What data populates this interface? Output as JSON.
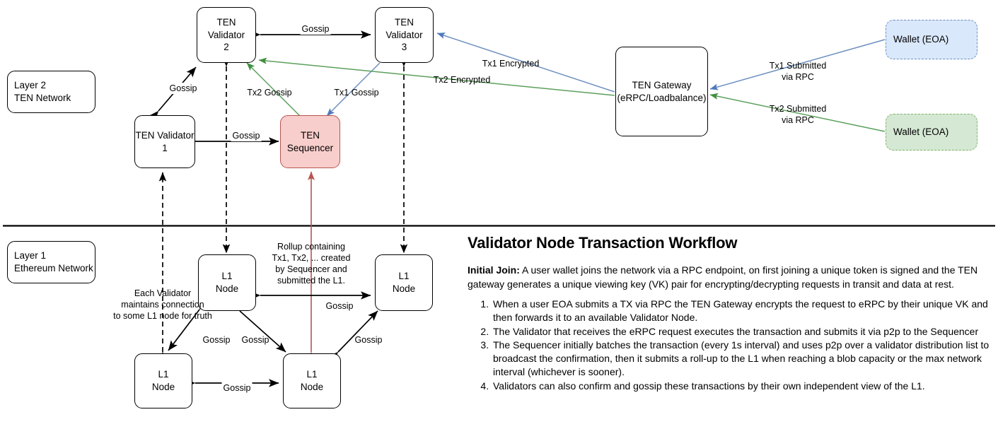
{
  "diagram": {
    "layers": [
      {
        "id": "layer2",
        "label": "Layer 2\nTEN Network"
      },
      {
        "id": "layer1",
        "label": "Layer 1\nEthereum Network"
      }
    ],
    "l2_nodes": [
      {
        "id": "validator2",
        "label": "TEN Validator\n2"
      },
      {
        "id": "validator3",
        "label": "TEN Validator\n3"
      },
      {
        "id": "validator1",
        "label": "TEN Validator\n1"
      },
      {
        "id": "sequencer",
        "label": "TEN\nSequencer"
      },
      {
        "id": "gateway",
        "label": "TEN Gateway\n(eRPC/Loadbalance)"
      }
    ],
    "wallets": [
      {
        "id": "wallet-blue",
        "label": "Wallet (EOA)"
      },
      {
        "id": "wallet-green",
        "label": "Wallet (EOA)"
      }
    ],
    "l1_nodes": [
      {
        "id": "l1-top-left",
        "label": "L1\nNode"
      },
      {
        "id": "l1-top-right",
        "label": "L1\nNode"
      },
      {
        "id": "l1-bottom-left",
        "label": "L1\nNode"
      },
      {
        "id": "l1-bottom-right",
        "label": "L1\nNode"
      }
    ],
    "edge_labels": [
      {
        "id": "gossip-v2-v3",
        "text": "Gossip"
      },
      {
        "id": "gossip-v1-v2",
        "text": "Gossip"
      },
      {
        "id": "gossip-v1-seq",
        "text": "Gossip"
      },
      {
        "id": "tx2-gossip",
        "text": "Tx2 Gossip"
      },
      {
        "id": "tx1-gossip",
        "text": "Tx1 Gossip"
      },
      {
        "id": "tx1-encrypted",
        "text": "Tx1 Encrypted"
      },
      {
        "id": "tx2-encrypted",
        "text": "Tx2 Encrypted"
      },
      {
        "id": "tx1-submitted",
        "text": "Tx1 Submitted\nvia RPC"
      },
      {
        "id": "tx2-submitted",
        "text": "Tx2 Submitted\nvia RPC"
      },
      {
        "id": "rollup-note",
        "text": "Rollup containing\nTx1, Tx2, ... created\nby Sequencer and\nsubmitted the L1."
      },
      {
        "id": "validator-connection-note",
        "text": "Each Validator\nmaintains connection\nto some L1 node for truth"
      },
      {
        "id": "gossip-l1-top",
        "text": "Gossip"
      },
      {
        "id": "gossip-l1-left-diag",
        "text": "Gossip"
      },
      {
        "id": "gossip-l1-mid-diag",
        "text": "Gossip"
      },
      {
        "id": "gossip-l1-right-diag",
        "text": "Gossip"
      },
      {
        "id": "gossip-l1-bottom",
        "text": "Gossip"
      }
    ],
    "colors": {
      "sequencer_fill": "#f8cecc",
      "sequencer_stroke": "#b85450",
      "wallet_blue_fill": "#dae8fc",
      "wallet_blue_stroke": "#6c8ebf",
      "wallet_green_fill": "#d5e8d4",
      "wallet_green_stroke": "#82b366",
      "default_stroke": "#000000",
      "rollup_arrow": "#b85450"
    }
  },
  "panel": {
    "title": "Validator Node Transaction Workflow",
    "intro_label": "Initial Join:",
    "intro_text": " A user wallet joins the network via a RPC endpoint, on first joining a unique token is signed and the TEN gateway generates a unique viewing key (VK) pair for encrypting/decrypting requests in transit and data at rest.",
    "steps": [
      "When a user EOA submits a TX via RPC the TEN Gateway encrypts the request to eRPC by their unique VK and then forwards it to an available Validator Node.",
      "The Validator that receives the eRPC request executes the transaction and submits it via p2p to the Sequencer",
      "The Sequencer initially batches the transaction (every 1s interval) and uses p2p over a validator distribution list to broadcast the confirmation, then it submits a roll-up to the L1 when reaching a blob capacity or the max network interval (whichever is sooner).",
      "Validators can also confirm and gossip these transactions by their own independent view of the L1."
    ]
  }
}
